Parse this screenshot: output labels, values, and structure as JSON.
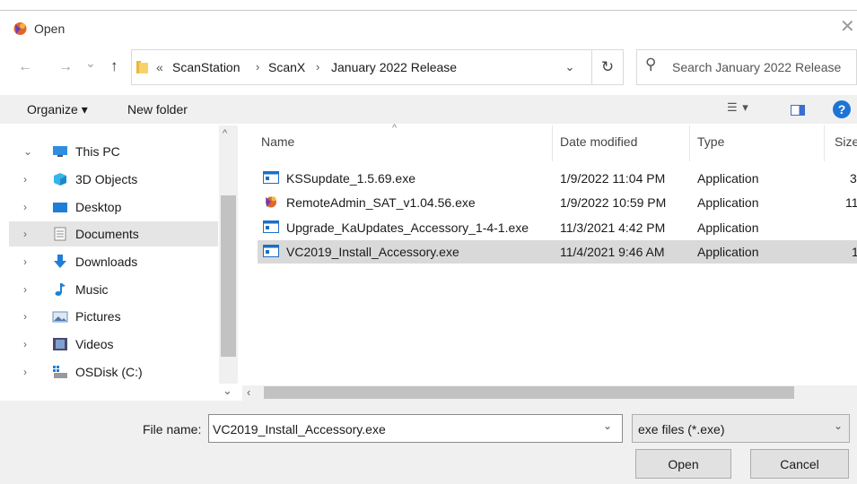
{
  "window": {
    "title": "Open",
    "close_glyph": "✕"
  },
  "nav": {
    "back": "←",
    "forward": "→",
    "recent": "⌄",
    "up": "↑",
    "breadcrumb_overflow": "«",
    "breadcrumb": [
      "ScanStation",
      "ScanX",
      "January 2022 Release"
    ],
    "crumb_sep": "›",
    "address_dropdown": "⌄",
    "refresh": "↻",
    "search_placeholder": "Search January 2022 Release"
  },
  "toolbar": {
    "organize": "Organize ▾",
    "new_folder": "New folder",
    "help": "?"
  },
  "sidebar": {
    "items": [
      {
        "label": "This PC",
        "icon": "pc-icon",
        "expanded": true
      },
      {
        "label": "3D Objects",
        "icon": "cube-icon"
      },
      {
        "label": "Desktop",
        "icon": "desktop-icon"
      },
      {
        "label": "Documents",
        "icon": "documents-icon",
        "selected": true
      },
      {
        "label": "Downloads",
        "icon": "download-icon"
      },
      {
        "label": "Music",
        "icon": "music-icon"
      },
      {
        "label": "Pictures",
        "icon": "pictures-icon"
      },
      {
        "label": "Videos",
        "icon": "videos-icon"
      },
      {
        "label": "OSDisk (C:)",
        "icon": "drive-icon"
      }
    ]
  },
  "columns": {
    "name": "Name",
    "date": "Date modified",
    "type": "Type",
    "size": "Size"
  },
  "files": [
    {
      "name": "KSSupdate_1.5.69.exe",
      "date": "1/9/2022 11:04 PM",
      "type": "Application",
      "size": "3",
      "icon": "exe-icon"
    },
    {
      "name": "RemoteAdmin_SAT_v1.04.56.exe",
      "date": "1/9/2022 10:59 PM",
      "type": "Application",
      "size": "11",
      "icon": "app-logo-icon"
    },
    {
      "name": "Upgrade_KaUpdates_Accessory_1-4-1.exe",
      "date": "11/3/2021 4:42 PM",
      "type": "Application",
      "size": "",
      "icon": "exe-icon"
    },
    {
      "name": "VC2019_Install_Accessory.exe",
      "date": "11/4/2021 9:46 AM",
      "type": "Application",
      "size": "1",
      "icon": "exe-icon",
      "selected": true
    }
  ],
  "footer": {
    "file_name_label": "File name:",
    "file_name_value": "VC2019_Install_Accessory.exe",
    "file_type_value": "exe files (*.exe)",
    "open": "Open",
    "cancel": "Cancel"
  }
}
